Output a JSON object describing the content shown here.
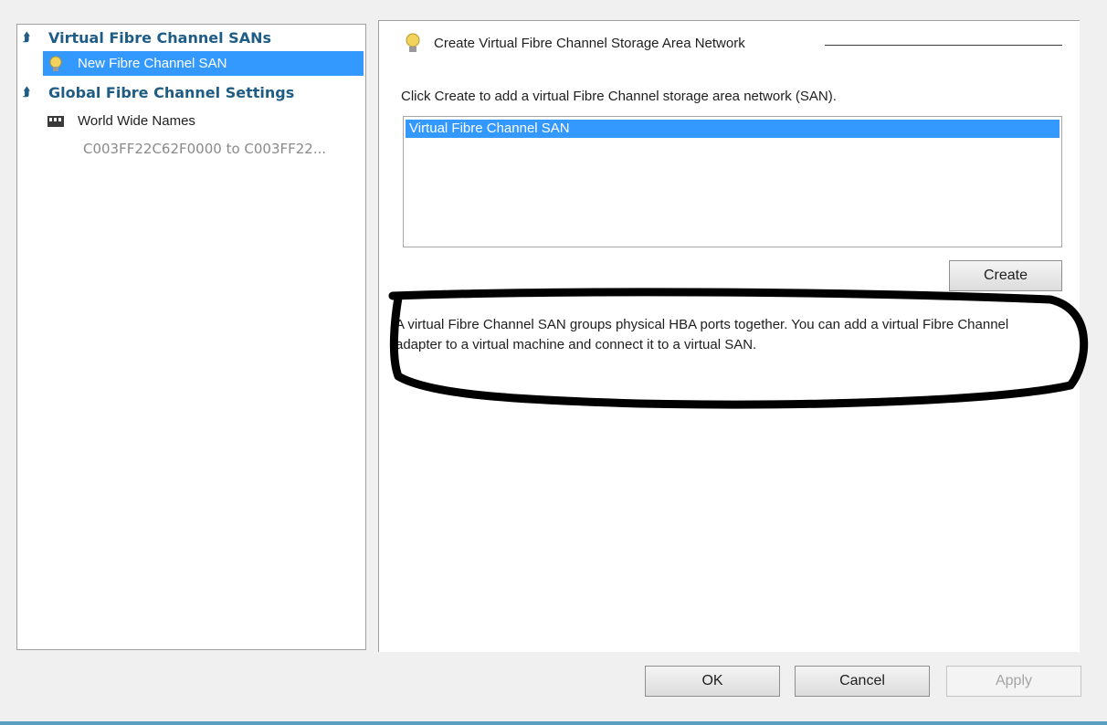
{
  "sidebar": {
    "sections": [
      {
        "title": "Virtual Fibre Channel SANs",
        "items": [
          {
            "label": "New Fibre Channel SAN",
            "icon": "new-san-icon",
            "selected": true
          }
        ]
      },
      {
        "title": "Global Fibre Channel Settings",
        "items": [
          {
            "label": "World Wide Names",
            "icon": "world-wide-names-icon",
            "sublabel": "C003FF22C62F0000 to C003FF22..."
          }
        ]
      }
    ]
  },
  "main": {
    "group_title": "Create Virtual Fibre Channel Storage Area Network",
    "instruction": "Click Create to add a virtual Fibre Channel storage area network (SAN).",
    "list_items": [
      "Virtual Fibre Channel SAN"
    ],
    "create_button": "Create",
    "description": "A virtual Fibre Channel SAN groups physical HBA ports together. You can add a virtual Fibre Channel adapter to a virtual machine and connect it to a virtual SAN."
  },
  "footer": {
    "ok": "OK",
    "cancel": "Cancel",
    "apply": "Apply"
  },
  "colors": {
    "selection": "#3399ff",
    "section_header": "#1f5d86",
    "annotation": "#000000"
  }
}
